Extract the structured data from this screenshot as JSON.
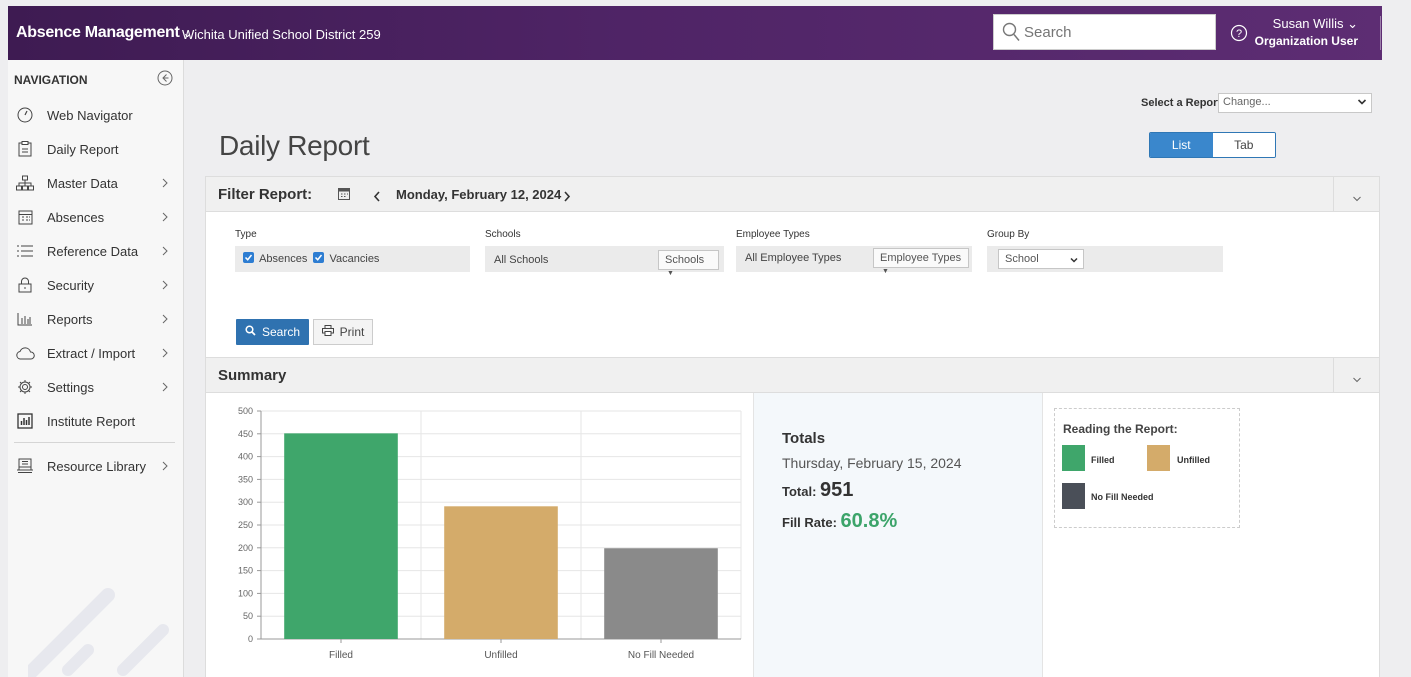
{
  "header": {
    "app_title": "Absence Management",
    "district": "Wichita Unified School District 259",
    "search_placeholder": "Search",
    "user_name": "Susan Willis",
    "user_role": "Organization User"
  },
  "sidebar": {
    "title": "NAVIGATION",
    "items": [
      {
        "label": "Web Navigator",
        "icon": "speedometer-icon",
        "has_children": false
      },
      {
        "label": "Daily Report",
        "icon": "clipboard-icon",
        "has_children": false
      },
      {
        "label": "Master Data",
        "icon": "org-chart-icon",
        "has_children": true
      },
      {
        "label": "Absences",
        "icon": "calendar-icon",
        "has_children": true
      },
      {
        "label": "Reference Data",
        "icon": "list-icon",
        "has_children": true
      },
      {
        "label": "Security",
        "icon": "lock-icon",
        "has_children": true
      },
      {
        "label": "Reports",
        "icon": "bar-chart-icon",
        "has_children": true
      },
      {
        "label": "Extract / Import",
        "icon": "cloud-icon",
        "has_children": true
      },
      {
        "label": "Settings",
        "icon": "gear-icon",
        "has_children": true
      },
      {
        "label": "Institute Report",
        "icon": "report-chart-icon",
        "has_children": false
      },
      {
        "label": "Resource Library",
        "icon": "library-icon",
        "has_children": true
      }
    ]
  },
  "report_select": {
    "label": "Select a Report",
    "value": "Change..."
  },
  "page": {
    "title": "Daily Report",
    "view_toggle": {
      "list": "List",
      "tab": "Tab",
      "active": "List"
    }
  },
  "filter": {
    "title": "Filter Report:",
    "date": "Monday, February 12, 2024",
    "type_label": "Type",
    "type_absences": "Absences",
    "type_vacancies": "Vacancies",
    "schools_label": "Schools",
    "schools_value": "All Schools",
    "schools_button": "Schools",
    "employee_types_label": "Employee Types",
    "employee_types_value": "All Employee Types",
    "employee_types_button": "Employee Types",
    "group_by_label": "Group By",
    "group_by_value": "School",
    "search_button": "Search",
    "print_button": "Print"
  },
  "summary": {
    "title": "Summary",
    "totals_title": "Totals",
    "totals_date": "Thursday, February 15, 2024",
    "total_label": "Total:",
    "total_value": "951",
    "fill_rate_label": "Fill Rate:",
    "fill_rate_value": "60.8%"
  },
  "legend": {
    "title": "Reading the Report:",
    "items": [
      {
        "label": "Filled",
        "color": "#3fa66b"
      },
      {
        "label": "Unfilled",
        "color": "#d4ab6a"
      },
      {
        "label": "No Fill Needed",
        "color": "#4a4f58"
      }
    ]
  },
  "chart_data": {
    "type": "bar",
    "categories": [
      "Filled",
      "Unfilled",
      "No Fill Needed"
    ],
    "values": [
      451,
      291,
      199
    ],
    "colors": [
      "#3fa66b",
      "#d4ab6a",
      "#8a8a8a"
    ],
    "ylim": [
      0,
      500
    ],
    "yticks": [
      0,
      50,
      100,
      150,
      200,
      250,
      300,
      350,
      400,
      450,
      500
    ],
    "grid": true
  }
}
